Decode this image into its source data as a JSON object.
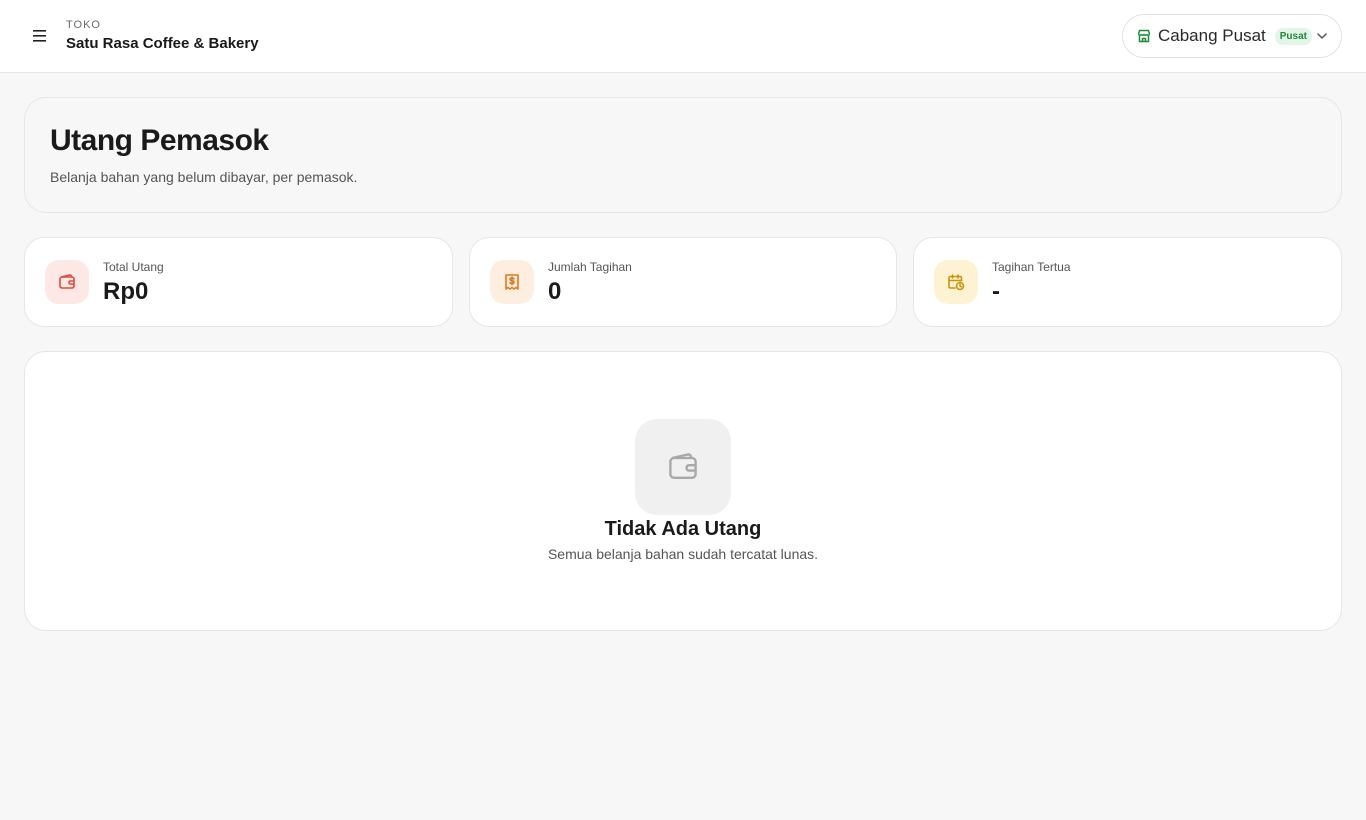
{
  "header": {
    "store_label": "TOKO",
    "store_name": "Satu Rasa Coffee & Bakery",
    "branch": {
      "name": "Cabang Pusat",
      "badge": "Pusat"
    }
  },
  "page": {
    "title": "Utang Pemasok",
    "subtitle": "Belanja bahan yang belum dibayar, per pemasok."
  },
  "stats": [
    {
      "label": "Total Utang",
      "value": "Rp0",
      "icon": "wallet-icon",
      "icon_color": "#e04a3a",
      "icon_bg": "#fde8e6"
    },
    {
      "label": "Jumlah Tagihan",
      "value": "0",
      "icon": "receipt-dollar-icon",
      "icon_color": "#e07b1f",
      "icon_bg": "#fdeee0"
    },
    {
      "label": "Tagihan Tertua",
      "value": "-",
      "icon": "calendar-clock-icon",
      "icon_color": "#c9940a",
      "icon_bg": "#fdf3d3"
    }
  ],
  "empty_state": {
    "icon": "wallet-icon",
    "title": "Tidak Ada Utang",
    "description": "Semua belanja bahan sudah tercatat lunas."
  },
  "colors": {
    "accent_green": "#1f8a3a",
    "badge_bg": "#e3f5e7"
  }
}
